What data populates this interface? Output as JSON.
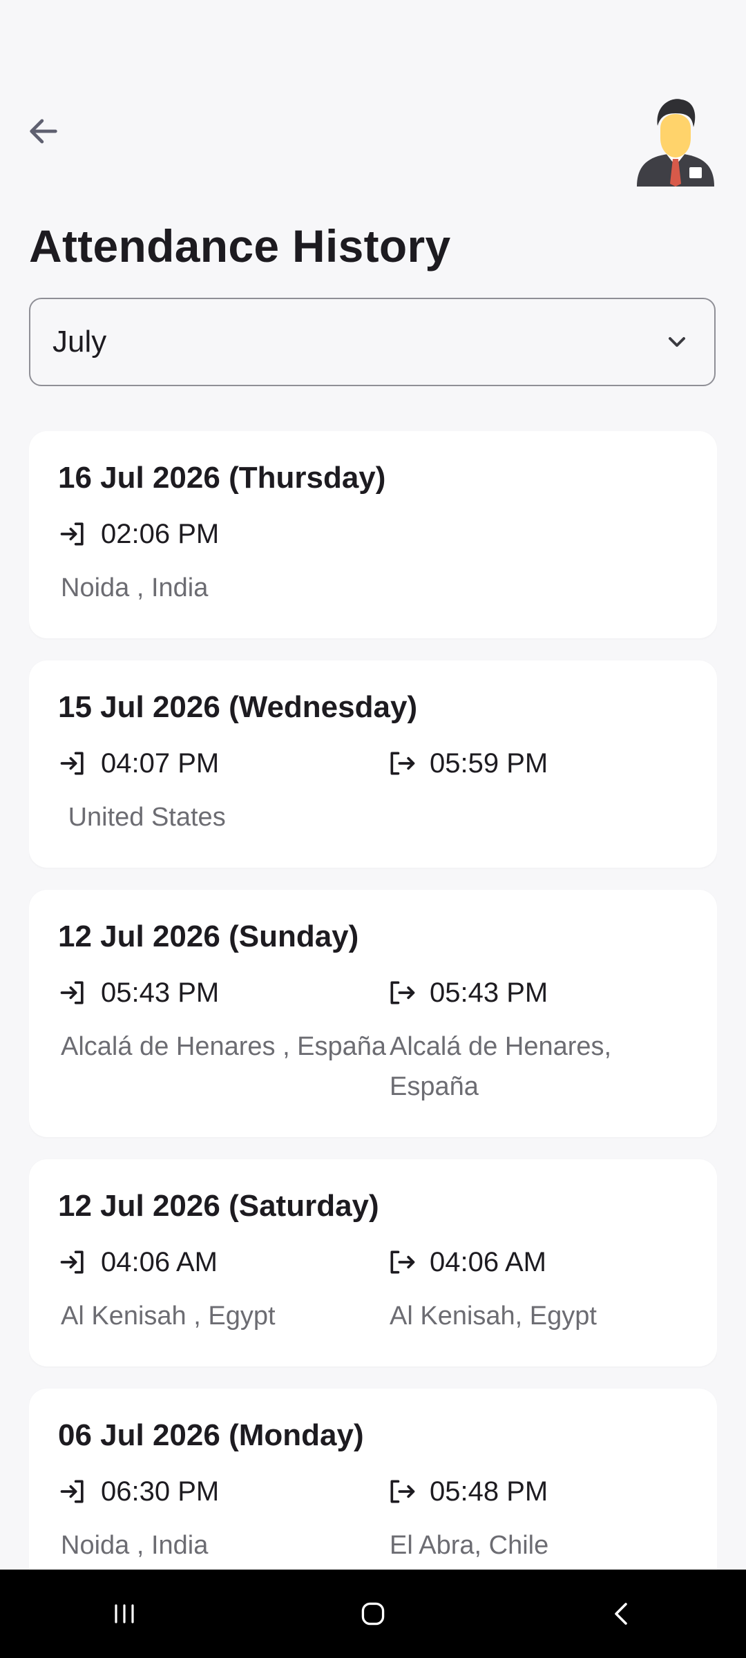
{
  "header": {
    "back_icon": "arrow-left-icon",
    "avatar_icon": "businessman-avatar-icon"
  },
  "page": {
    "title": "Attendance History"
  },
  "month_select": {
    "value": "July",
    "icon": "chevron-down-icon"
  },
  "colors": {
    "background": "#f7f7f9",
    "card": "#ffffff",
    "text_primary": "#1d1b20",
    "text_secondary": "#6c6c72",
    "border": "#8f8f96"
  },
  "records": [
    {
      "date": "16 Jul 2026 (Thursday)",
      "check_in": {
        "time": "02:06 PM",
        "location": "Noida , India"
      },
      "check_out": null
    },
    {
      "date": "15 Jul 2026 (Wednesday)",
      "check_in": {
        "time": "04:07 PM",
        "location": " United States"
      },
      "check_out": {
        "time": "05:59 PM",
        "location": ""
      }
    },
    {
      "date": "12 Jul 2026 (Sunday)",
      "check_in": {
        "time": "05:43 PM",
        "location": "Alcalá de Henares , España"
      },
      "check_out": {
        "time": "05:43 PM",
        "location": "Alcalá de Henares, España"
      }
    },
    {
      "date": "12 Jul 2026 (Saturday)",
      "check_in": {
        "time": "04:06 AM",
        "location": "Al Kenisah , Egypt"
      },
      "check_out": {
        "time": "04:06 AM",
        "location": "Al Kenisah, Egypt"
      }
    },
    {
      "date": "06 Jul 2026 (Monday)",
      "check_in": {
        "time": "06:30 PM",
        "location": "Noida , India"
      },
      "check_out": {
        "time": "05:48 PM",
        "location": "El Abra, Chile"
      }
    }
  ],
  "icons": {
    "check_in": "login-icon",
    "check_out": "logout-icon"
  },
  "nav": {
    "recents_icon": "recent-apps-icon",
    "home_icon": "home-icon",
    "back_icon": "back-chevron-icon"
  }
}
